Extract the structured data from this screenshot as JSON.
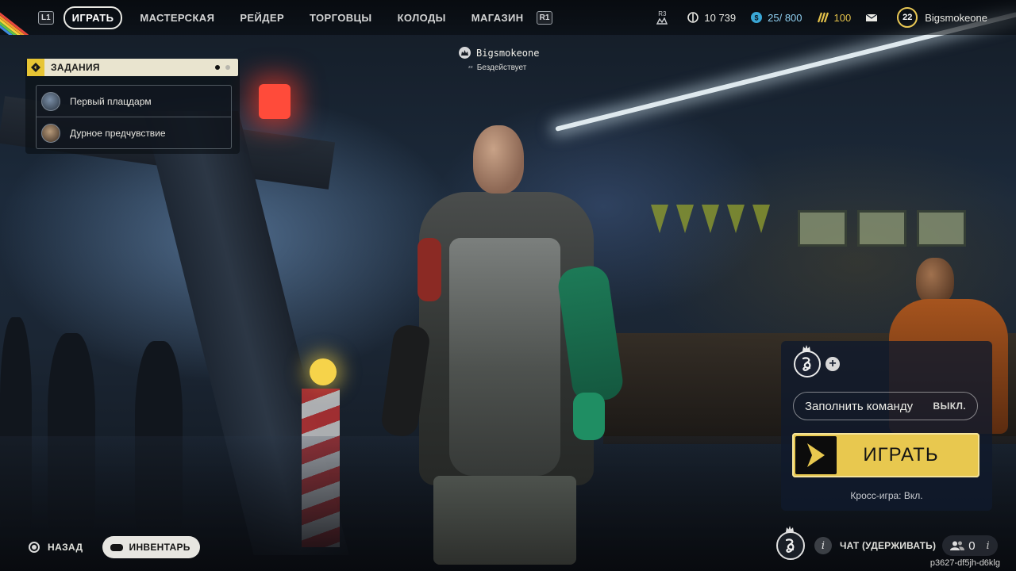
{
  "nav": {
    "left_hint": "L1",
    "right_hint": "R1",
    "items": [
      {
        "label": "ИГРАТЬ",
        "active": true
      },
      {
        "label": "МАСТЕРСКАЯ",
        "active": false
      },
      {
        "label": "РЕЙДЕР",
        "active": false
      },
      {
        "label": "ТОРГОВЦЫ",
        "active": false
      },
      {
        "label": "КОЛОДЫ",
        "active": false
      },
      {
        "label": "МАГАЗИН",
        "active": false
      }
    ]
  },
  "status": {
    "r3_hint": "R3",
    "currency_main": "10 739",
    "currency_secondary": "25/ 800",
    "tokens": "100",
    "player_level": "22",
    "player_name": "Bigsmokeone"
  },
  "quests": {
    "title": "ЗАДАНИЯ",
    "items": [
      {
        "label": "Первый плацдарм"
      },
      {
        "label": "Дурное предчувствие"
      }
    ]
  },
  "player_tag": {
    "name": "Bigsmokeone",
    "status": "Бездействует"
  },
  "squad_panel": {
    "fill_team_label": "Заполнить команду",
    "fill_team_value": "ВЫКЛ.",
    "play_label": "ИГРАТЬ",
    "crossplay": "Кросс-игра: Вкл."
  },
  "bottom": {
    "back_label": "НАЗАД",
    "inventory_label": "ИНВЕНТАРЬ",
    "chat_label": "ЧАТ (УДЕРЖИВАТЬ)",
    "party_count": "0",
    "session_id": "p3627-df5jh-d6klg"
  },
  "colors": {
    "accent_yellow": "#e8c84f",
    "panel_navy": "#101a2c",
    "quest_header": "#e9e4cf"
  }
}
